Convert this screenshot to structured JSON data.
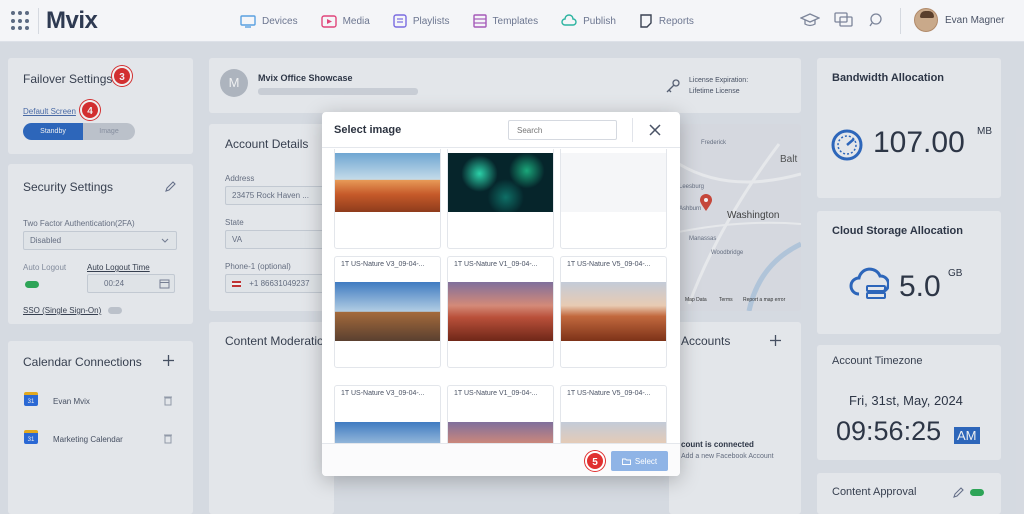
{
  "app": {
    "logo": "Mvix"
  },
  "nav": [
    {
      "label": "Devices",
      "icon": "monitor-icon"
    },
    {
      "label": "Media",
      "icon": "media-icon"
    },
    {
      "label": "Playlists",
      "icon": "playlist-icon"
    },
    {
      "label": "Templates",
      "icon": "template-icon"
    },
    {
      "label": "Publish",
      "icon": "publish-icon"
    },
    {
      "label": "Reports",
      "icon": "reports-icon"
    }
  ],
  "user": {
    "name": "Evan Magner"
  },
  "failover": {
    "title": "Failover Settings",
    "badge": "3",
    "default_screen": "Default Screen",
    "badge2": "4",
    "toggle_on": "Standby",
    "toggle_off": "Image"
  },
  "security": {
    "title": "Security Settings",
    "tfa_label": "Two Factor Authentication(2FA)",
    "tfa_value": "Disabled",
    "auto_logout": "Auto Logout",
    "auto_logout_time": "Auto Logout Time",
    "time_value": "00:24",
    "sso": "SSO (Single Sign-On)"
  },
  "calendar": {
    "title": "Calendar Connections",
    "items": [
      {
        "name": "Evan Mvix",
        "icon_text": "31"
      },
      {
        "name": "Marketing Calendar",
        "icon_text": "31"
      }
    ]
  },
  "showcase": {
    "avatar_letter": "M",
    "title": "Mvix Office Showcase",
    "license_label": "License Expiration:",
    "license_value": "Lifetime License"
  },
  "account": {
    "title": "Account Details",
    "address_label": "Address",
    "address_value": "23475 Rock Haven ...",
    "state_label": "State",
    "state_value": "VA",
    "phone_label": "Phone-1 (optional)",
    "phone_value": "+1 86631049237"
  },
  "moderation": {
    "title": "Content Moderation"
  },
  "map": {
    "places": [
      "Frederick",
      "Balt",
      "Leesburg",
      "Ashburn",
      "Washington",
      "Manassas",
      "Woodbridge"
    ],
    "footer": [
      "Map Data",
      "Terms",
      "Report a map error"
    ]
  },
  "social": {
    "title": "Accounts",
    "connected": "count is connected",
    "add_link": "Add a new Facebook Account"
  },
  "bandwidth": {
    "title": "Bandwidth Allocation",
    "value": "107.00",
    "unit": "MB"
  },
  "storage": {
    "title": "Cloud Storage Allocation",
    "value": "5.0",
    "unit": "GB"
  },
  "timezone": {
    "title": "Account Timezone",
    "date": "Fri, 31st, May, 2024",
    "time": "09:56:25",
    "ampm": "AM"
  },
  "approval": {
    "title": "Content Approval"
  },
  "modal": {
    "title": "Select image",
    "search_placeholder": "Search",
    "select_label": "Select",
    "badge": "5",
    "rows": [
      [
        {
          "label": "",
          "scene": "desert"
        },
        {
          "label": "",
          "scene": "dark"
        },
        {
          "label": "",
          "scene": "blank"
        }
      ],
      [
        {
          "label": "1T US-Nature V3_09-04-...",
          "scene": "road"
        },
        {
          "label": "1T US-Nature V1_09-04-...",
          "scene": "red"
        },
        {
          "label": "1T US-Nature V5_09-04-...",
          "scene": "sunset"
        }
      ],
      [
        {
          "label": "1T US-Nature V3_09-04-...",
          "scene": "road"
        },
        {
          "label": "1T US-Nature V1_09-04-...",
          "scene": "red"
        },
        {
          "label": "1T US-Nature V5_09-04-...",
          "scene": "sunset"
        }
      ]
    ]
  }
}
